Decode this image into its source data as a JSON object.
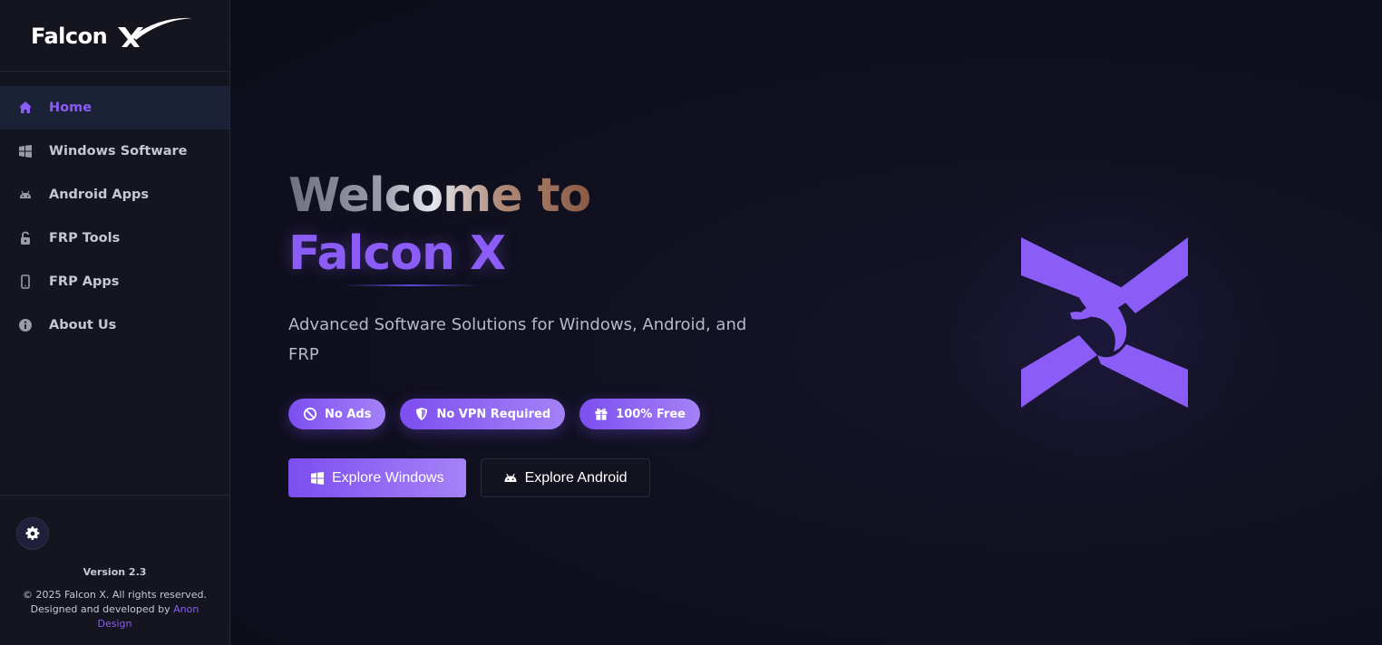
{
  "brand": {
    "name": "Falcon X",
    "logo_text": "Falcon"
  },
  "sidebar": {
    "items": [
      {
        "label": "Home",
        "icon": "home-icon",
        "active": true
      },
      {
        "label": "Windows Software",
        "icon": "windows-icon",
        "active": false
      },
      {
        "label": "Android Apps",
        "icon": "android-icon",
        "active": false
      },
      {
        "label": "FRP Tools",
        "icon": "unlock-icon",
        "active": false
      },
      {
        "label": "FRP Apps",
        "icon": "mobile-icon",
        "active": false
      },
      {
        "label": "About Us",
        "icon": "info-icon",
        "active": false
      }
    ],
    "footer": {
      "version": "Version 2.3",
      "copyright": "© 2025 Falcon X. All rights reserved.",
      "designed_by": "Designed and developed by",
      "designer": "Anon Design"
    }
  },
  "hero": {
    "title_line1": "Welcome to",
    "title_line2": "Falcon X",
    "subtitle": "Advanced Software Solutions for Windows, Android, and FRP",
    "badges": [
      {
        "label": "No Ads",
        "icon": "ban-icon"
      },
      {
        "label": "No VPN Required",
        "icon": "shield-icon"
      },
      {
        "label": "100% Free",
        "icon": "gift-icon"
      }
    ],
    "buttons": {
      "primary": "Explore Windows",
      "secondary": "Explore Android"
    }
  },
  "colors": {
    "accent": "#8b5cf6",
    "sidebar_bg": "#151520",
    "main_bg": "#0f0f1b",
    "active_nav_bg": "#1b2238"
  }
}
